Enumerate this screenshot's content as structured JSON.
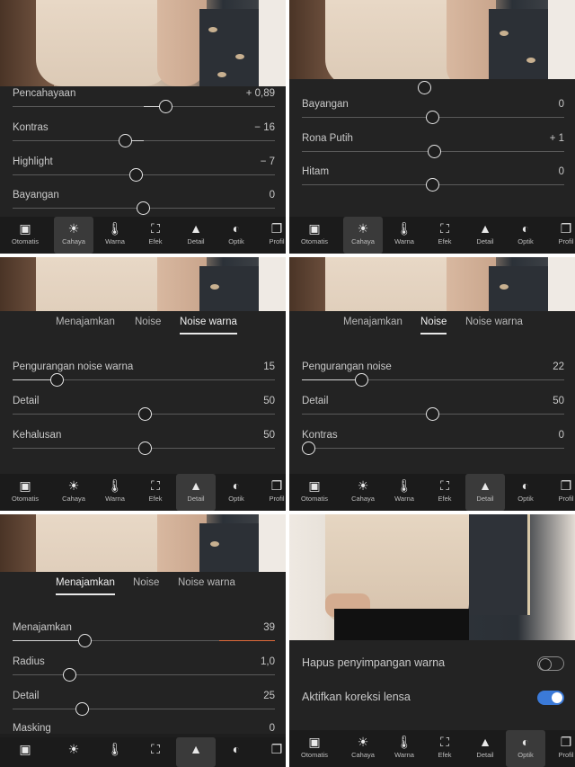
{
  "tool_labels": {
    "auto": "Otomatis",
    "light": "Cahaya",
    "color": "Warna",
    "effects": "Efek",
    "detail": "Detail",
    "optics": "Optik",
    "profile": "Profil"
  },
  "p1": {
    "rows": [
      {
        "label": "Pencahayaan",
        "value": "+ 0,89",
        "pos": 0.57
      },
      {
        "label": "Kontras",
        "value": "− 16",
        "pos": 0.42
      },
      {
        "label": "Highlight",
        "value": "− 7",
        "pos": 0.47
      },
      {
        "label": "Bayangan",
        "value": "0",
        "pos": 0.5
      }
    ]
  },
  "p2": {
    "rows": [
      {
        "label": "Bayangan",
        "value": "0",
        "pos": 0.5
      },
      {
        "label": "Rona Putih",
        "value": "+ 1",
        "pos": 0.51
      },
      {
        "label": "Hitam",
        "value": "0",
        "pos": 0.5
      }
    ]
  },
  "p3": {
    "tabs": [
      "Menajamkan",
      "Noise",
      "Noise warna"
    ],
    "rows": [
      {
        "label": "Pengurangan noise warna",
        "value": "15",
        "pos": 0.15
      },
      {
        "label": "Detail",
        "value": "50",
        "pos": 0.5
      },
      {
        "label": "Kehalusan",
        "value": "50",
        "pos": 0.5
      }
    ]
  },
  "p4": {
    "tabs": [
      "Menajamkan",
      "Noise",
      "Noise warna"
    ],
    "rows": [
      {
        "label": "Pengurangan noise",
        "value": "22",
        "pos": 0.22
      },
      {
        "label": "Detail",
        "value": "50",
        "pos": 0.5
      },
      {
        "label": "Kontras",
        "value": "0",
        "pos": 0.0
      }
    ]
  },
  "p5": {
    "tabs": [
      "Menajamkan",
      "Noise",
      "Noise warna"
    ],
    "rows": [
      {
        "label": "Menajamkan",
        "value": "39",
        "pos": 0.26
      },
      {
        "label": "Radius",
        "value": "1,0",
        "pos": 0.2
      },
      {
        "label": "Detail",
        "value": "25",
        "pos": 0.25
      },
      {
        "label": "Masking",
        "value": "0",
        "pos": 0.0
      }
    ]
  },
  "p6": {
    "toggles": [
      {
        "label": "Hapus penyimpangan warna",
        "on": false
      },
      {
        "label": "Aktifkan koreksi lensa",
        "on": true
      }
    ]
  },
  "colors": {
    "accent": "#3b7ad8",
    "panel": "#1e1e1e",
    "slider_active": "#e06a3a"
  }
}
